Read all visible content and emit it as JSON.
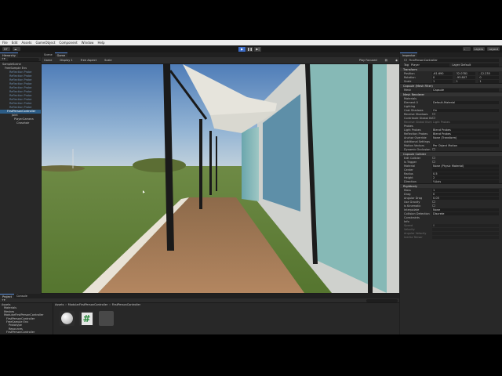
{
  "menu": [
    "File",
    "Edit",
    "Assets",
    "GameObject",
    "Component",
    "Window",
    "Help"
  ],
  "toolbar": {
    "account": "DT",
    "services_icon": "cloud-icon",
    "play_icons": [
      "play-icon",
      "pause-icon",
      "step-icon"
    ],
    "layers": "Layers",
    "layout": "Layout"
  },
  "hierarchy": {
    "tab": "Hierarchy",
    "items": [
      {
        "label": "SampleScene",
        "state": "scene"
      },
      {
        "label": "FreeSample Env",
        "state": "normal"
      },
      {
        "label": "Reflection Probe",
        "state": "dim"
      },
      {
        "label": "Reflection Probe",
        "state": "dim"
      },
      {
        "label": "Reflection Probe",
        "state": "dim"
      },
      {
        "label": "Reflection Probe",
        "state": "dim"
      },
      {
        "label": "Reflection Probe",
        "state": "dim"
      },
      {
        "label": "Reflection Probe",
        "state": "dim"
      },
      {
        "label": "Reflection Probe",
        "state": "dim"
      },
      {
        "label": "Reflection Probe",
        "state": "dim"
      },
      {
        "label": "Reflection Probe",
        "state": "dim"
      },
      {
        "label": "Reflection Probe",
        "state": "dim"
      },
      {
        "label": "FirstPersonController",
        "state": "selected"
      },
      {
        "label": "Joint",
        "state": "normal"
      },
      {
        "label": "PlayerCamera",
        "state": "normal"
      },
      {
        "label": "Crosshair",
        "state": "normal"
      }
    ]
  },
  "scene_tabs": {
    "scene": "Scene",
    "game": "Game"
  },
  "game_toolbar": {
    "display": "Game",
    "display_num": "Display 1",
    "aspect": "Free Aspect",
    "scale": "Scale",
    "play_focused": "Play Focused"
  },
  "inspector": {
    "tab": "Inspector",
    "object_name": "FirstPersonController",
    "tag_label": "Tag",
    "tag": "Player",
    "layer_label": "Layer",
    "layer": "Default",
    "transform": {
      "title": "Transform",
      "position": {
        "label": "Position",
        "x": "-61.690",
        "y": "32.0781",
        "z": "-12.235"
      },
      "rotation": {
        "label": "Rotation",
        "x": "0",
        "y": "-93.807",
        "z": "0"
      },
      "scale": {
        "label": "Scale",
        "x": "1",
        "y": "1",
        "z": "1"
      }
    },
    "mesh_filter": {
      "title": "Capsule (Mesh Filter)",
      "mesh_label": "Mesh",
      "mesh": "Capsule"
    },
    "mesh_renderer": {
      "title": "Mesh Renderer",
      "element": "Element 0",
      "material": "Default-Material"
    },
    "materials_label": "Materials",
    "lighting": {
      "title": "Lighting",
      "cast_shadows_label": "Cast Shadows",
      "cast_shadows": "On",
      "receive_shadows": "Receive Shadows",
      "contribute_gi": "Contribute Global Illum",
      "receive_gi": "Receive Global Illumination",
      "receive_gi_value": "Light Probes"
    },
    "probes": {
      "title": "Probes",
      "light_probes": "Light Probes",
      "light_probes_value": "Blend Probes",
      "reflection_probes": "Reflection Probes",
      "reflection_probes_value": "Blend Probes",
      "anchor": "Anchor Override",
      "anchor_value": "None (Transform)"
    },
    "additional": {
      "title": "Additional Settings",
      "motion_vectors": "Motion Vectors",
      "motion_vectors_value": "Per Object Motion",
      "dynamic_occlusion": "Dynamic Occlusion"
    },
    "capsule_collider": {
      "title": "Capsule Collider",
      "edit": "Edit Collider",
      "is_trigger": "Is Trigger",
      "material": "Material",
      "material_value": "None (Physic Material)",
      "center": "Center",
      "radius": "Radius",
      "radius_value": "0.5",
      "height": "Height",
      "height_value": "2",
      "direction": "Direction",
      "direction_value": "Y-Axis"
    },
    "rigidbody": {
      "title": "Rigidbody",
      "mass": "Mass",
      "mass_value": "1",
      "drag": "Drag",
      "drag_value": "0",
      "angular_drag": "Angular Drag",
      "angular_drag_value": "0.05",
      "use_gravity": "Use Gravity",
      "is_kinematic": "Is Kinematic",
      "interpolate": "Interpolate",
      "interpolate_value": "None",
      "collision": "Collision Detection",
      "collision_value": "Discrete",
      "constraints": "Constraints",
      "info": "Info",
      "speed": "Speed",
      "speed_value": "0",
      "velocity": "Velocity",
      "angular_velocity": "Angular Velocity",
      "inertia": "Inertia Tensor"
    }
  },
  "project": {
    "tabs": [
      "Project",
      "Console"
    ],
    "folders": [
      "Assets",
      "Materials",
      "Meshes",
      "ModularFirstPersonController",
      "FirstPersonController",
      "FreeSample Env",
      "Prototype",
      "Resources",
      "FirstPersonController"
    ],
    "breadcrumb": [
      "Assets",
      "ModularFirstPersonController",
      "FirstPersonController"
    ],
    "assets": [
      {
        "icon": "sphere-asset-icon"
      },
      {
        "icon": "script-asset-icon",
        "glyph": "#"
      },
      {
        "icon": "folder-asset-icon"
      }
    ]
  },
  "colors": {
    "accent": "#3d6cc6",
    "selection": "#2c5d87",
    "panel": "#282828",
    "header": "#333333"
  }
}
